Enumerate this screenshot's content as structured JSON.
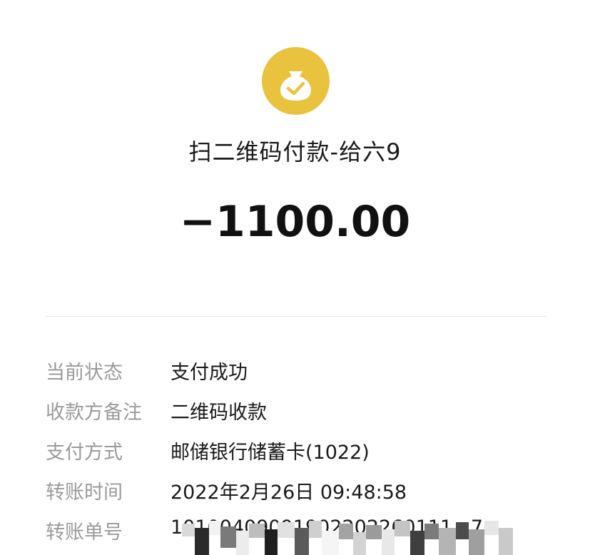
{
  "header": {
    "icon": "money-bag-check-icon",
    "icon_color": "#e9c23e",
    "merchant_title": "扫二维码付款-给六9",
    "amount": "−1100.00"
  },
  "details": [
    {
      "label": "当前状态",
      "value": "支付成功"
    },
    {
      "label": "收款方备注",
      "value": "二维码收款"
    },
    {
      "label": "支付方式",
      "value": "邮储银行储蓄卡(1022)"
    },
    {
      "label": "转账时间",
      "value": "2022年2月26日 09:48:58"
    },
    {
      "label": "转账单号",
      "value": "10100409091902202260111...7"
    }
  ]
}
